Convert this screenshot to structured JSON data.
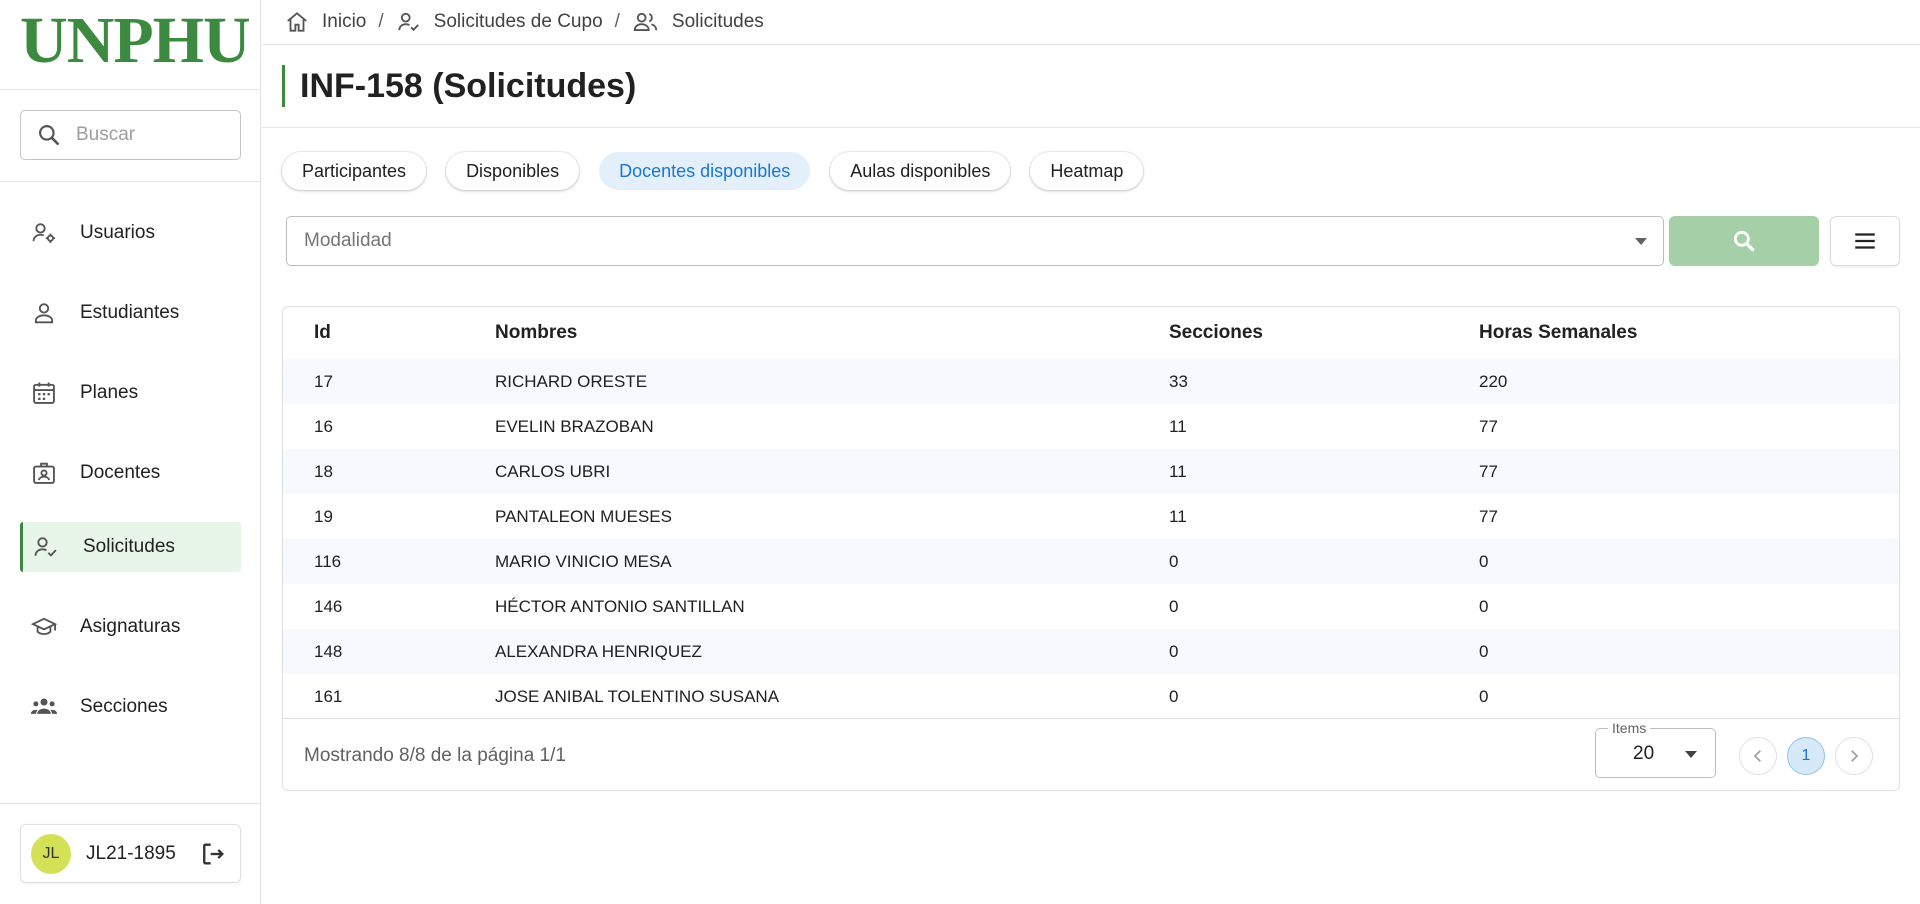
{
  "sidebar": {
    "logo": "UNPHU",
    "search_placeholder": "Buscar",
    "items": [
      {
        "label": "Usuarios"
      },
      {
        "label": "Estudiantes"
      },
      {
        "label": "Planes"
      },
      {
        "label": "Docentes"
      },
      {
        "label": "Solicitudes",
        "active": true
      },
      {
        "label": "Asignaturas"
      },
      {
        "label": "Secciones"
      }
    ],
    "user": {
      "initials": "JL",
      "name": "JL21-1895"
    }
  },
  "breadcrumb": [
    "Inicio",
    "Solicitudes de Cupo",
    "Solicitudes"
  ],
  "page_title": "INF-158 (Solicitudes)",
  "tabs": [
    {
      "label": "Participantes"
    },
    {
      "label": "Disponibles"
    },
    {
      "label": "Docentes disponibles",
      "active": true
    },
    {
      "label": "Aulas disponibles"
    },
    {
      "label": "Heatmap"
    }
  ],
  "filter": {
    "placeholder": "Modalidad"
  },
  "table": {
    "columns": [
      "Id",
      "Nombres",
      "Secciones",
      "Horas Semanales"
    ],
    "rows": [
      [
        "17",
        "RICHARD ORESTE",
        "33",
        "220"
      ],
      [
        "16",
        "EVELIN BRAZOBAN",
        "11",
        "77"
      ],
      [
        "18",
        "CARLOS UBRI",
        "11",
        "77"
      ],
      [
        "19",
        "PANTALEON MUESES",
        "11",
        "77"
      ],
      [
        "116",
        "MARIO VINICIO MESA",
        "0",
        "0"
      ],
      [
        "146",
        "HÉCTOR ANTONIO SANTILLAN",
        "0",
        "0"
      ],
      [
        "148",
        "ALEXANDRA HENRIQUEZ",
        "0",
        "0"
      ],
      [
        "161",
        "JOSE ANIBAL TOLENTINO SUSANA",
        "0",
        "0"
      ]
    ],
    "footer": {
      "showing": "Mostrando 8/8 de la página 1/1",
      "items_label": "Items",
      "items_value": "20",
      "current_page": "1"
    }
  },
  "colors": {
    "brand": "#3c8a3f",
    "accent": "#1976d2",
    "search_button": "#a5d0a7"
  }
}
